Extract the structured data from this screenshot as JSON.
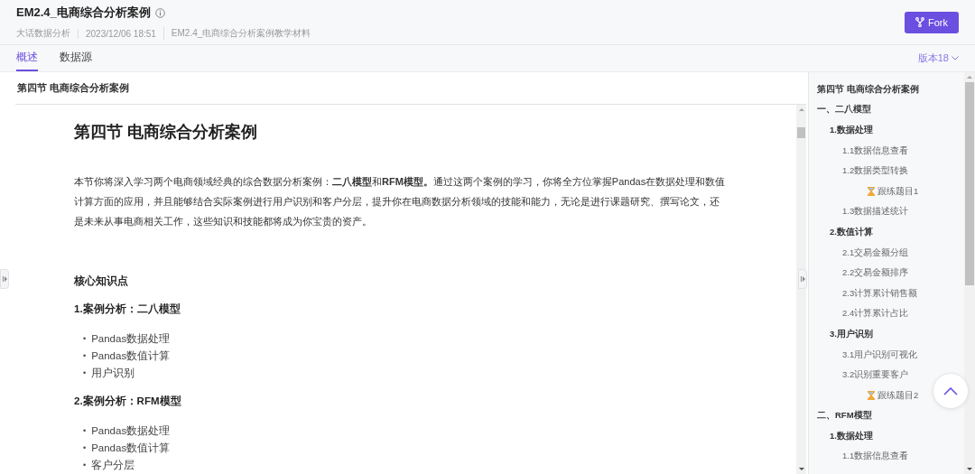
{
  "header": {
    "title": "EM2.4_电商综合分析案例",
    "meta": [
      "大话数据分析",
      "2023/12/06 18:51",
      "EM2.4_电商综合分析案例教学材料"
    ],
    "fork_button": "Fork"
  },
  "tabs": [
    {
      "label": "概述",
      "selected": true
    },
    {
      "label": "数据源",
      "selected": false
    }
  ],
  "version": "版本18",
  "panel_title": "第四节 电商综合分析案例",
  "document": {
    "title": "第四节 电商综合分析案例",
    "intro": "本节你将深入学习两个电商领域经典的综合数据分析案例：**二八模型**和**RFM模型。**通过这两个案例的学习，你将全方位掌握Pandas在数据处理和数值计算方面的应用，并且能够结合实际案例进行用户识别和客户分层，提升你在电商数据分析领域的技能和能力，无论是进行课题研究、撰写论文，还是未来从事电商相关工作，这些知识和技能都将成为你宝贵的资产。",
    "section_heading": "核心知识点",
    "cases": [
      {
        "heading": "1.案例分析：二八模型",
        "bullets": [
          {
            "marker": "•",
            "text": "Pandas数据处理"
          },
          {
            "marker": "•",
            "text": "Pandas数值计算"
          },
          {
            "marker": "•",
            "text": "用户识别"
          }
        ]
      },
      {
        "heading": "2.案例分析：RFM模型",
        "bullets": [
          {
            "marker": "•",
            "text": "Pandas数据处理"
          },
          {
            "marker": "•",
            "text": "Pandas数值计算"
          },
          {
            "marker": "•",
            "text": "客户分层"
          }
        ]
      }
    ]
  },
  "toc": {
    "title": "第四节 电商综合分析案例",
    "items": [
      {
        "label": "一、二八模型",
        "kind": "heading",
        "children": [
          {
            "label": "1.数据处理",
            "kind": "heading",
            "children": [
              {
                "label": "1.1数据信息查看",
                "kind": "topic"
              },
              {
                "label": "1.2数据类型转换",
                "kind": "topic",
                "children": [
                  {
                    "label": "跟练题目1",
                    "kind": "exercise"
                  }
                ]
              },
              {
                "label": "1.3数据描述统计",
                "kind": "topic"
              }
            ]
          },
          {
            "label": "2.数值计算",
            "kind": "heading",
            "children": [
              {
                "label": "2.1交易金额分组",
                "kind": "topic"
              },
              {
                "label": "2.2交易金额排序",
                "kind": "topic"
              },
              {
                "label": "2.3计算累计销售额",
                "kind": "topic"
              },
              {
                "label": "2.4计算累计占比",
                "kind": "topic"
              }
            ]
          },
          {
            "label": "3.用户识别",
            "kind": "heading",
            "children": [
              {
                "label": "3.1用户识别可视化",
                "kind": "topic"
              },
              {
                "label": "3.2识别重要客户",
                "kind": "topic",
                "children": [
                  {
                    "label": "跟练题目2",
                    "kind": "exercise"
                  }
                ]
              }
            ]
          }
        ]
      },
      {
        "label": "二、RFM模型",
        "kind": "heading",
        "children": [
          {
            "label": "1.数据处理",
            "kind": "heading",
            "children": [
              {
                "label": "1.1数据信息查看",
                "kind": "topic"
              }
            ]
          }
        ]
      }
    ]
  }
}
